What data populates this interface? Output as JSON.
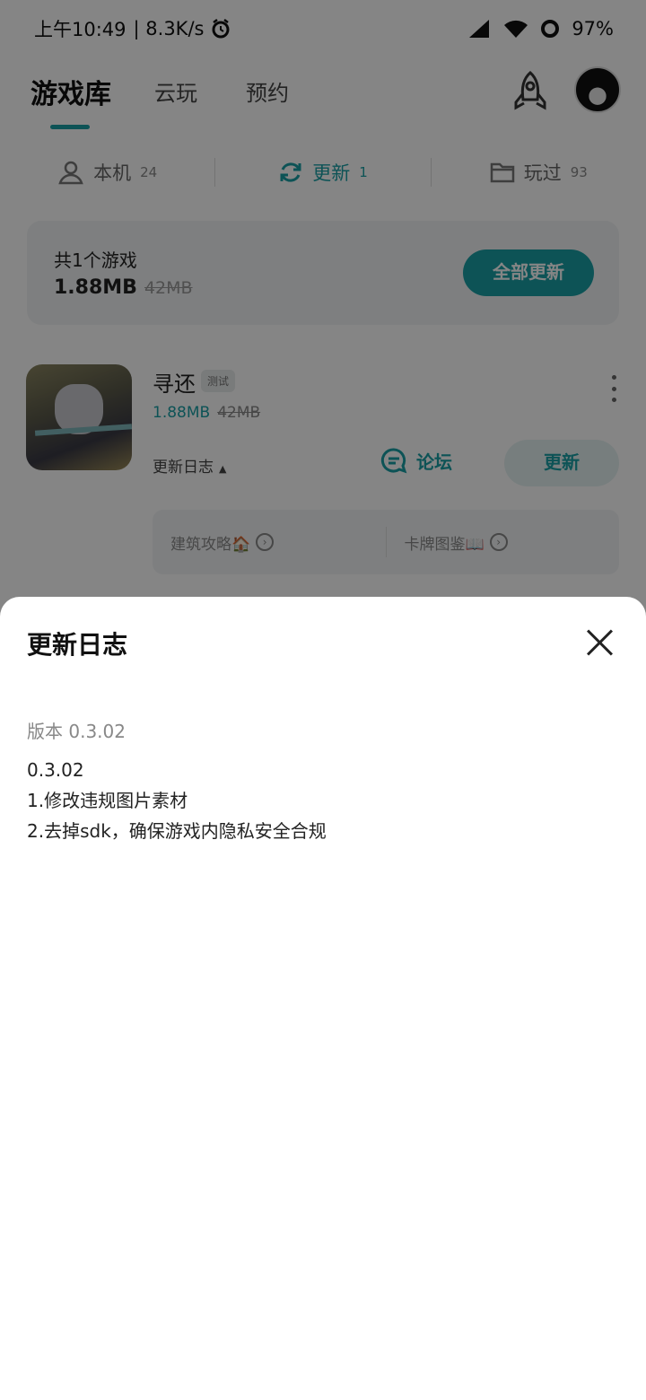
{
  "status_bar": {
    "time": "上午10:49",
    "net_speed": "| 8.3K/s",
    "battery": "97%"
  },
  "top_nav": {
    "tabs": [
      {
        "label": "游戏库"
      },
      {
        "label": "云玩"
      },
      {
        "label": "预约"
      }
    ]
  },
  "sub_tabs": [
    {
      "label": "本机",
      "count": "24"
    },
    {
      "label": "更新",
      "count": "1"
    },
    {
      "label": "玩过",
      "count": "93"
    }
  ],
  "summary": {
    "count_text": "共1个游戏",
    "size": "1.88MB",
    "old_size": "42MB",
    "update_all_label": "全部更新"
  },
  "game": {
    "name": "寻还",
    "tag": "测试",
    "size": "1.88MB",
    "old_size": "42MB",
    "changelog_label": "更新日志",
    "forum_label": "论坛",
    "update_label": "更新",
    "guides": [
      {
        "label": "建筑攻略🏠"
      },
      {
        "label": "卡牌图鉴📖"
      }
    ]
  },
  "sheet": {
    "title": "更新日志",
    "version": "版本 0.3.02",
    "notes": [
      "0.3.02",
      "1.修改违规图片素材",
      "2.去掉sdk，确保游戏内隐私安全合规"
    ]
  },
  "colors": {
    "accent": "#1aa0a6",
    "overlay": "rgba(0,0,0,0.48)"
  }
}
